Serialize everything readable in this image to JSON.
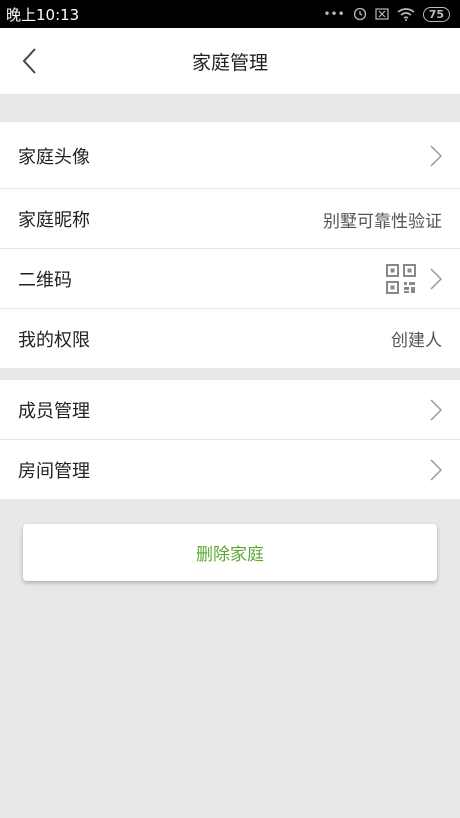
{
  "status": {
    "time": "晚上10:13",
    "battery": "75"
  },
  "nav": {
    "title": "家庭管理",
    "back_icon": "chevron-left-icon"
  },
  "rows": {
    "avatar": {
      "label": "家庭头像"
    },
    "nickname": {
      "label": "家庭昵称",
      "value": "别墅可靠性验证"
    },
    "qrcode": {
      "label": "二维码",
      "icon": "qr-code-icon"
    },
    "permission": {
      "label": "我的权限",
      "value": "创建人"
    },
    "members": {
      "label": "成员管理"
    },
    "rooms": {
      "label": "房间管理"
    }
  },
  "delete_button": {
    "label": "删除家庭"
  },
  "colors": {
    "accent_green": "#5aa832",
    "background": "#e8e8ea",
    "statusbar": "#000000"
  }
}
